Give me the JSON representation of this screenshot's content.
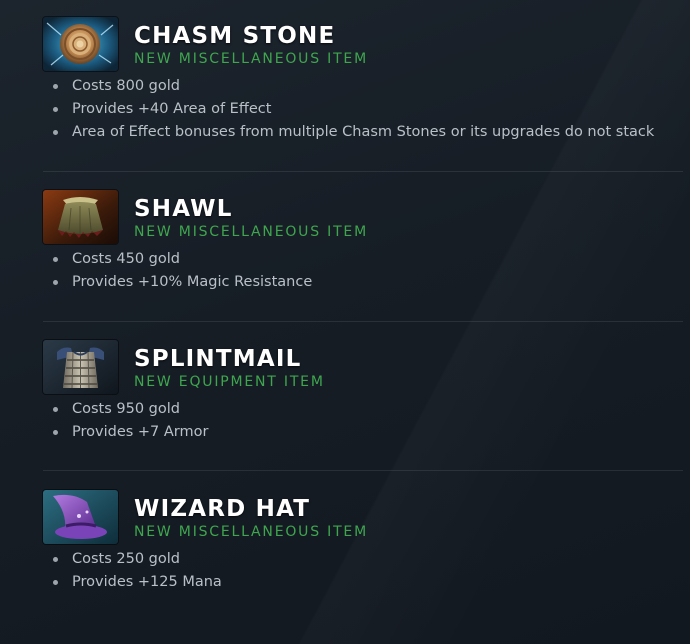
{
  "items": [
    {
      "name": "CHASM STONE",
      "tag": "NEW MISCELLANEOUS ITEM",
      "icon": "chasm-stone-icon",
      "bullets": [
        "Costs 800 gold",
        "Provides +40 Area of Effect",
        "Area of Effect bonuses from multiple Chasm Stones or its upgrades do not stack"
      ]
    },
    {
      "name": "SHAWL",
      "tag": "NEW MISCELLANEOUS ITEM",
      "icon": "shawl-icon",
      "bullets": [
        "Costs 450 gold",
        "Provides +10% Magic Resistance"
      ]
    },
    {
      "name": "SPLINTMAIL",
      "tag": "NEW EQUIPMENT ITEM",
      "icon": "splintmail-icon",
      "bullets": [
        "Costs 950 gold",
        "Provides +7 Armor"
      ]
    },
    {
      "name": "WIZARD HAT",
      "tag": "NEW MISCELLANEOUS ITEM",
      "icon": "wizard-hat-icon",
      "bullets": [
        "Costs 250 gold",
        "Provides +125 Mana"
      ]
    }
  ],
  "colors": {
    "background": "#161d25",
    "title": "#ffffff",
    "tag": "#3fa64f",
    "bullet_text": "#b9c0c7",
    "divider": "#2a323a"
  }
}
